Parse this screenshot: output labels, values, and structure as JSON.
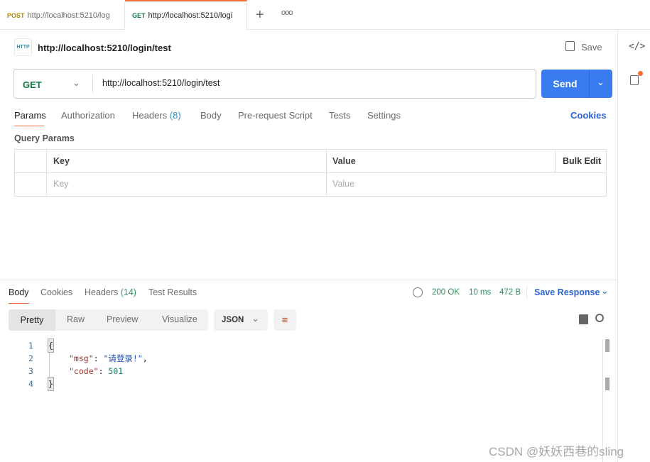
{
  "tabs": [
    {
      "method": "POST",
      "url": "http://localhost:5210/log",
      "method_color": "#b88a00"
    },
    {
      "method": "GET",
      "url": "http://localhost:5210/logi",
      "method_color": "#0b7a3e",
      "active": true
    }
  ],
  "request": {
    "title": "http://localhost:5210/login/test",
    "save": "Save",
    "method": "GET",
    "url": "http://localhost:5210/login/test",
    "send": "Send"
  },
  "req_tabs": [
    "Params",
    "Authorization",
    "Headers",
    "(8)",
    "Body",
    "Pre-request Script",
    "Tests",
    "Settings"
  ],
  "cookies": "Cookies",
  "query_params": {
    "title": "Query Params",
    "col_key": "Key",
    "col_value": "Value",
    "bulk": "Bulk Edit",
    "ph_key": "Key",
    "ph_value": "Value"
  },
  "resp_tabs": [
    "Body",
    "Cookies",
    "Headers",
    "(14)",
    "Test Results"
  ],
  "status": {
    "code": "200 OK",
    "time": "10 ms",
    "size": "472 B",
    "save_response": "Save Response"
  },
  "view": [
    "Pretty",
    "Raw",
    "Preview",
    "Visualize"
  ],
  "format": "JSON",
  "code_lines": [
    {
      "n": "1",
      "t": "{"
    },
    {
      "n": "2",
      "k": "\"msg\"",
      "v": "\"请登录!\"",
      "end": ","
    },
    {
      "n": "3",
      "k": "\"code\"",
      "num": "501"
    },
    {
      "n": "4",
      "t": "}"
    }
  ],
  "watermark": "CSDN @妖妖西巷的sling",
  "colors": {
    "accent": "#f26b3a",
    "send": "#3a7cf0",
    "link": "#2b62d6",
    "ok": "#2f8f5f"
  }
}
